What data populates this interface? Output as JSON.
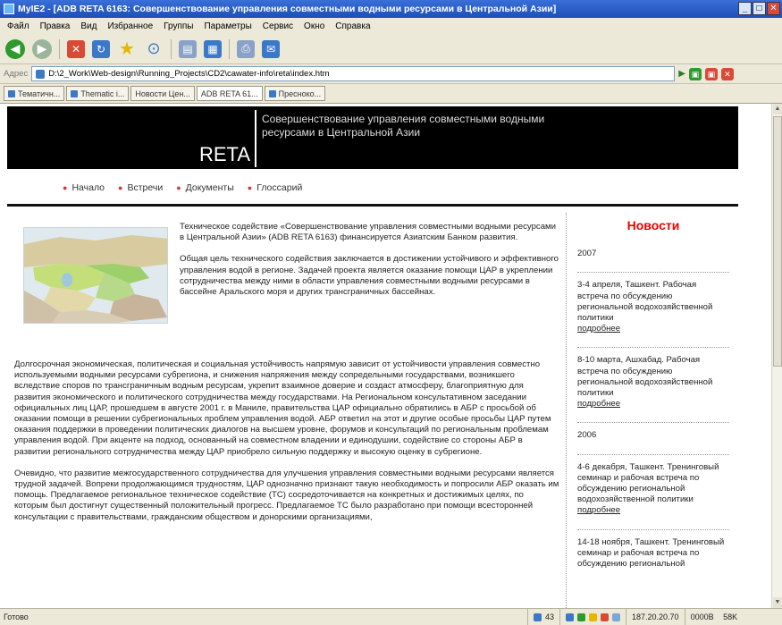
{
  "window": {
    "title": "MyIE2 - [ADB RETA 6163: Совершенствование управления совместными водными ресурсами в Центральной Азии]",
    "controls": [
      "_",
      "□",
      "✕"
    ]
  },
  "menu": [
    "Файл",
    "Правка",
    "Вид",
    "Избранное",
    "Группы",
    "Параметры",
    "Сервис",
    "Окно",
    "Справка"
  ],
  "address": {
    "label": "Адрес",
    "url": "D:\\2_Work\\Web-design\\Running_Projects\\CD2\\cawater-info\\reta\\index.htm"
  },
  "tabs": [
    "Тематичн...",
    "Thematic i...",
    "Новости Цен...",
    "ADB RETA 61...",
    "Пресноко..."
  ],
  "site": {
    "brand": "RETA",
    "title": "Совершенствование управления совместными водными ресурсами в Центральной Азии",
    "nav": [
      "Начало",
      "Встречи",
      "Документы",
      "Глоссарий"
    ]
  },
  "content": {
    "intro1": "Техническое содействие «Совершенствование управления совместными водными ресурсами в Центральной Азии» (ADB RETA 6163) финансируется Азиатским Банком развития.",
    "intro2": "Общая цель технического содействия заключается в достижении устойчивого и эффективного управления водой в регионе. Задачей проекта является оказание помощи ЦАР в укреплении сотрудничества между ними в области управления совместными водными ресурсами в бассейне Аральского моря и других трансграничных бассейнах.",
    "para1": "Долгосрочная экономическая, политическая и социальная устойчивость напрямую зависит от устойчивости управления совместно используемыми водными ресурсами субрегиона, и снижения напряжения между сопредельными государствами, возникшего вследствие споров по трансграничным водным ресурсам, укрепит взаимное доверие и создаст атмосферу, благоприятную для развития экономического и политического сотрудничества между государствами. На Региональном консультативном заседании официальных лиц ЦАР, прошедшем в августе 2001 г. в Маниле, правительства ЦАР официально обратились в АБР с просьбой об оказании помощи в решении субрегиональных проблем управления водой. АБР ответил на этот и другие особые просьбы ЦАР путем оказания поддержки в проведении политических диалогов на высшем уровне, форумов и консультаций по региональным проблемам управления водой. При акценте на подход, основанный на совместном владении и единодушии, содействие со стороны АБР в развитии регионального сотрудничества между ЦАР приобрело сильную поддержку и высокую оценку в субрегионе.",
    "para2": "Очевидно, что развитие межгосударственного сотрудничества для улучшения управления совместными водными ресурсами является трудной задачей. Вопреки продолжающимся трудностям, ЦАР однозначно признают такую необходимость и попросили АБР оказать им помощь. Предлагаемое региональное техническое содействие (ТС) сосредоточивается на конкретных и достижимых целях, по которым был достигнут существенный положительный прогресс. Предлагаемое ТС было разработано при помощи всесторонней консультации с правительствами, гражданским обществом и донорскими организациями,"
  },
  "news": {
    "title": "Новости",
    "more_label": "подробнее",
    "groups": [
      {
        "year": "2007",
        "items": [
          {
            "text": "3-4 апреля, Ташкент. Рабочая встреча по обсуждению региональной водохозяйственной политики"
          },
          {
            "text": "8-10 марта, Ашхабад. Рабочая встреча по обсуждению региональной водохозяйственной политики"
          }
        ]
      },
      {
        "year": "2006",
        "items": [
          {
            "text": "4-6 декабря, Ташкент. Тренинговый семинар и рабочая встреча по обсуждению региональной водохозяйственной политики"
          },
          {
            "text": "14-18 ноября, Ташкент. Тренинговый семинар и рабочая встреча по обсуждению региональной"
          }
        ]
      }
    ]
  },
  "status": {
    "text": "Готово",
    "count": "43",
    "ip": "187.20.20.70",
    "mem": "0000B",
    "mem2": "58K"
  }
}
